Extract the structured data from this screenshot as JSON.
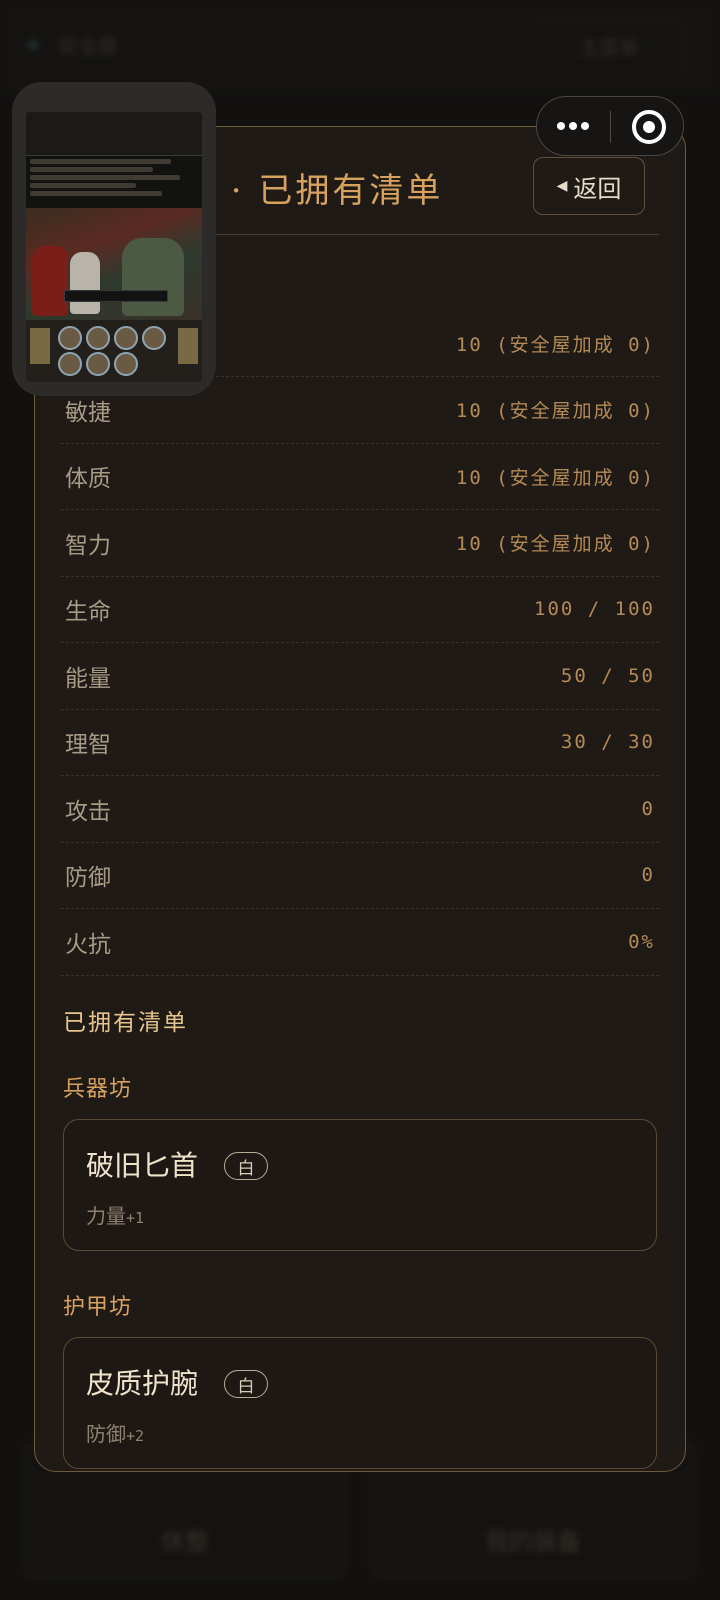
{
  "background": {
    "top_title": "安全屋",
    "top_button": "主菜单",
    "bottom_left_label": "休整",
    "bottom_right_label": "我的装备"
  },
  "modal": {
    "title": "备 · 已拥有清单",
    "back_button": "返回"
  },
  "stats": [
    {
      "label": "敏捷",
      "value": "10 (安全屋加成 0)"
    },
    {
      "label": "体质",
      "value": "10 (安全屋加成 0)"
    },
    {
      "label": "智力",
      "value": "10 (安全屋加成 0)"
    },
    {
      "label": "生命",
      "value": "100 / 100"
    },
    {
      "label": "能量",
      "value": "50 / 50"
    },
    {
      "label": "理智",
      "value": "30 / 30"
    },
    {
      "label": "攻击",
      "value": "0"
    },
    {
      "label": "防御",
      "value": "0"
    },
    {
      "label": "火抗",
      "value": "0%"
    }
  ],
  "hidden_first_stat_value": "10 (安全屋加成 0)",
  "owned_section_title": "已拥有清单",
  "categories": [
    {
      "title": "兵器坊",
      "items": [
        {
          "name": "破旧匕首",
          "rarity": "白",
          "stat": "力量",
          "bonus": "+1"
        }
      ]
    },
    {
      "title": "护甲坊",
      "items": [
        {
          "name": "皮质护腕",
          "rarity": "白",
          "stat": "防御",
          "bonus": "+2"
        }
      ]
    }
  ],
  "colors": {
    "accent_gold": "#d6a25e",
    "modal_bg": "#1f1a16",
    "border": "#6d5b3c"
  }
}
